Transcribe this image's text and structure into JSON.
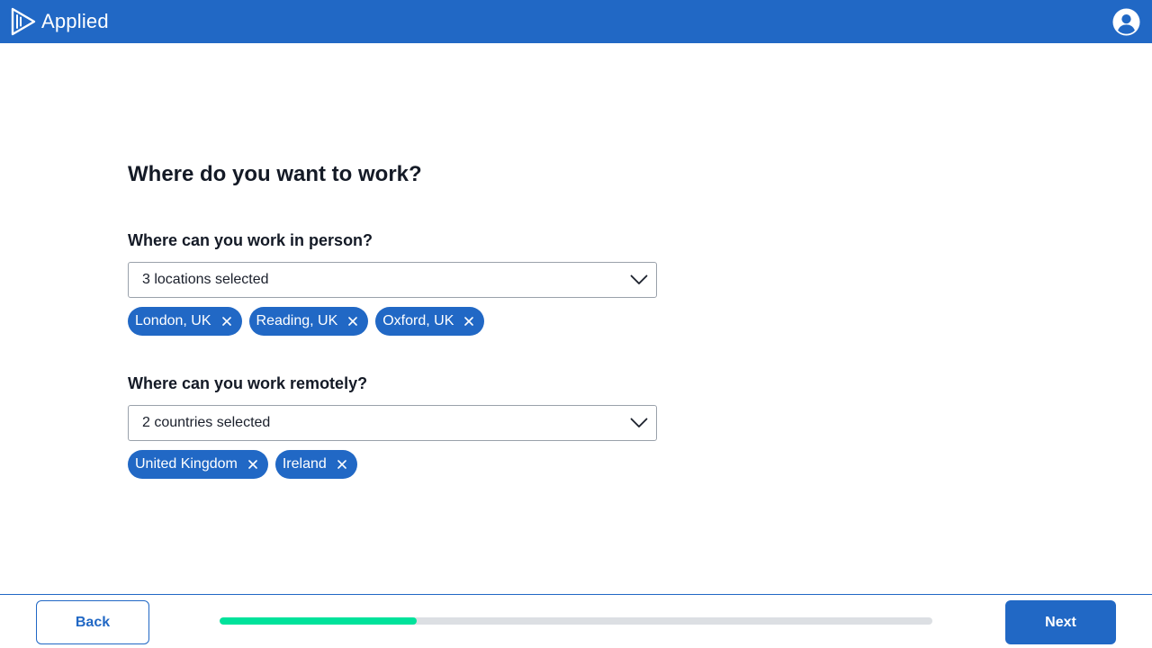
{
  "header": {
    "brand": "Applied",
    "icons": {
      "logo": "applied-logo",
      "account": "user-circle-icon"
    }
  },
  "main": {
    "title": "Where do you want to work?",
    "in_person": {
      "label": "Where can you work in person?",
      "selected_text": "3 locations selected",
      "chips": [
        "London, UK",
        "Reading, UK",
        "Oxford, UK"
      ]
    },
    "remote": {
      "label": "Where can you work remotely?",
      "selected_text": "2 countries selected",
      "chips": [
        "United Kingdom",
        "Ireland"
      ]
    }
  },
  "footer": {
    "back_label": "Back",
    "next_label": "Next",
    "progress": 0.277
  },
  "colors": {
    "brand": "#2168c5",
    "progress_fill": "#00e29b",
    "progress_track": "#dcdfe3"
  }
}
